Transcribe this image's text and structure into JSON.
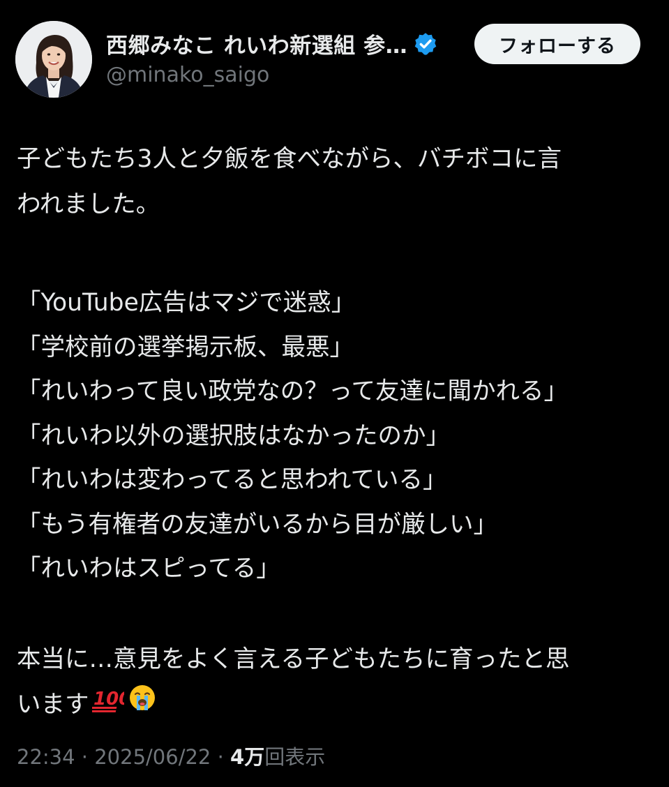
{
  "author": {
    "display_name": "西郷みなこ れいわ新選組 参…",
    "handle": "@minako_saigo",
    "verified": true,
    "avatar_icon": "profile-photo"
  },
  "follow_button": {
    "label": "フォローする"
  },
  "tweet": {
    "intro_line_1": "子どもたち3人と夕飯を食べながら、バチボコに言",
    "intro_line_2": "われました。",
    "quotes": [
      "「YouTube広告はマジで迷惑」",
      "「学校前の選挙掲示板、最悪」",
      "「れいわって良い政党なの？って友達に聞かれる」",
      "「れいわ以外の選択肢はなかったのか」",
      "「れいわは変わってると思われている」",
      "「もう有権者の友達がいるから目が厳しい」",
      "「れいわはスピってる」"
    ],
    "closing_line_1": "本当に…意見をよく言える子どもたちに育ったと思",
    "closing_line_2": "います",
    "closing_emojis": [
      "hundred-points-icon",
      "loudly-crying-face-icon"
    ]
  },
  "meta": {
    "time": "22:34",
    "separator": "·",
    "date": "2025/06/22",
    "views_count": "4万",
    "views_label": "回表示"
  },
  "colors": {
    "background": "#000000",
    "text_primary": "#e7e9ea",
    "text_secondary": "#71767b",
    "verified_blue": "#1d9bf0",
    "follow_button_bg": "#eff3f4"
  }
}
